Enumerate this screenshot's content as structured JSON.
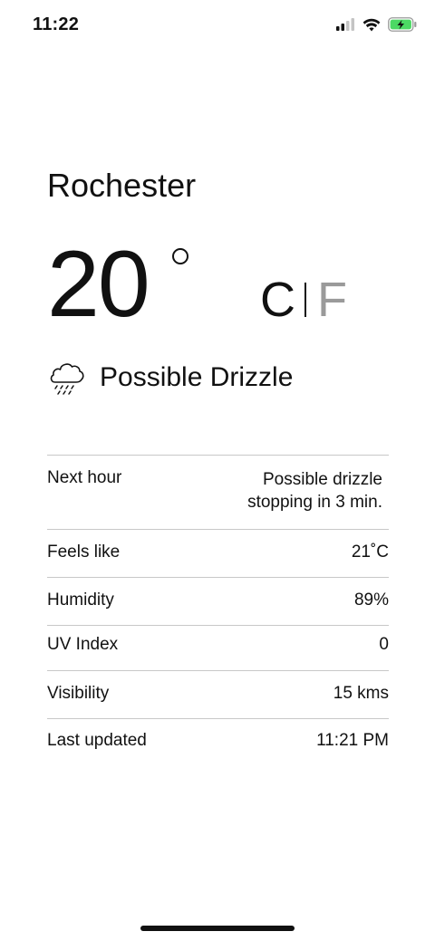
{
  "status_bar": {
    "time": "11:22",
    "icons": [
      "cellular-signal-icon",
      "wifi-icon",
      "battery-charging-icon"
    ],
    "battery_color": "#4cd964"
  },
  "weather": {
    "city": "Rochester",
    "temperature": "20",
    "unit_celsius": "C",
    "unit_fahrenheit": "F",
    "selected_unit": "C",
    "condition": "Possible Drizzle",
    "condition_icon": "cloud-drizzle-icon"
  },
  "details": [
    {
      "label": "Next hour",
      "value_line1": "Possible drizzle",
      "value_line2": "stopping in 3 min."
    },
    {
      "label": "Feels like",
      "value": "21˚C"
    },
    {
      "label": "Humidity",
      "value": "89%"
    },
    {
      "label": "UV Index",
      "value": "0"
    },
    {
      "label": "Visibility",
      "value": "15 kms"
    },
    {
      "label": "Last updated",
      "value": "11:21 PM"
    }
  ],
  "colors": {
    "text": "#111111",
    "muted_unit": "#9a9a9a",
    "divider": "#c8c8c8"
  }
}
